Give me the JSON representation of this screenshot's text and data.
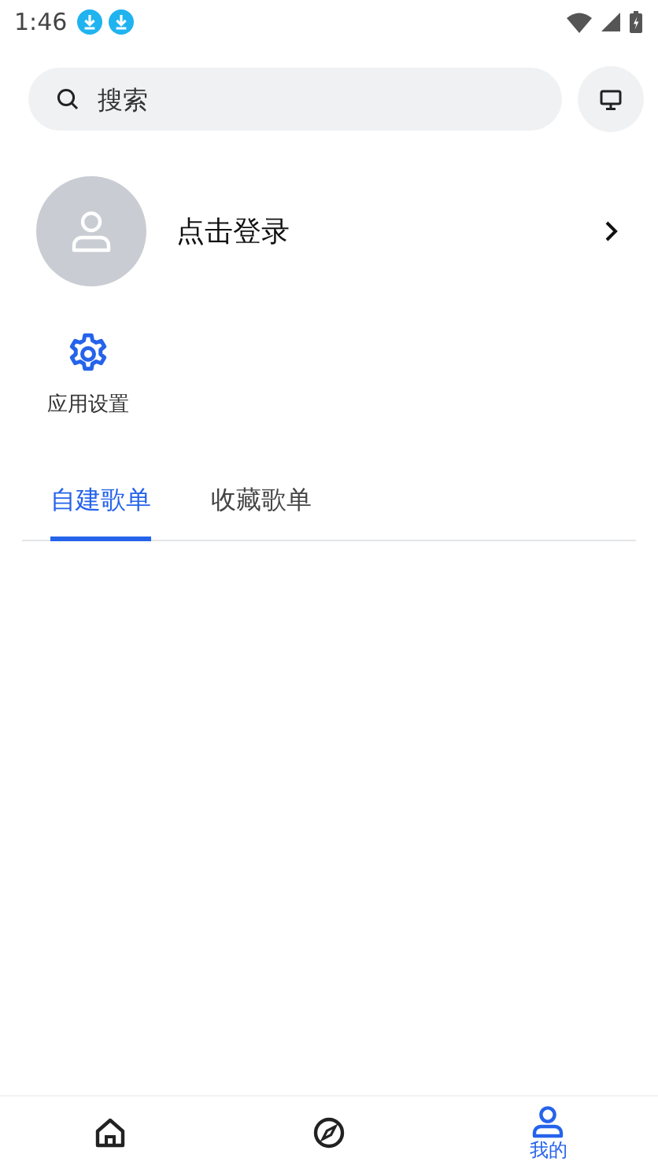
{
  "status_bar": {
    "time": "1:46"
  },
  "search": {
    "placeholder": "搜索"
  },
  "profile": {
    "login_text": "点击登录"
  },
  "shortcuts": [
    {
      "kind": "settings",
      "label": "应用设置"
    }
  ],
  "tabs": [
    {
      "label": "自建歌单",
      "selected": true
    },
    {
      "label": "收藏歌单",
      "selected": false
    }
  ],
  "bottom_nav": [
    {
      "kind": "home",
      "selected": false
    },
    {
      "kind": "discover",
      "selected": false
    },
    {
      "kind": "profile",
      "label": "我的",
      "selected": true
    }
  ]
}
